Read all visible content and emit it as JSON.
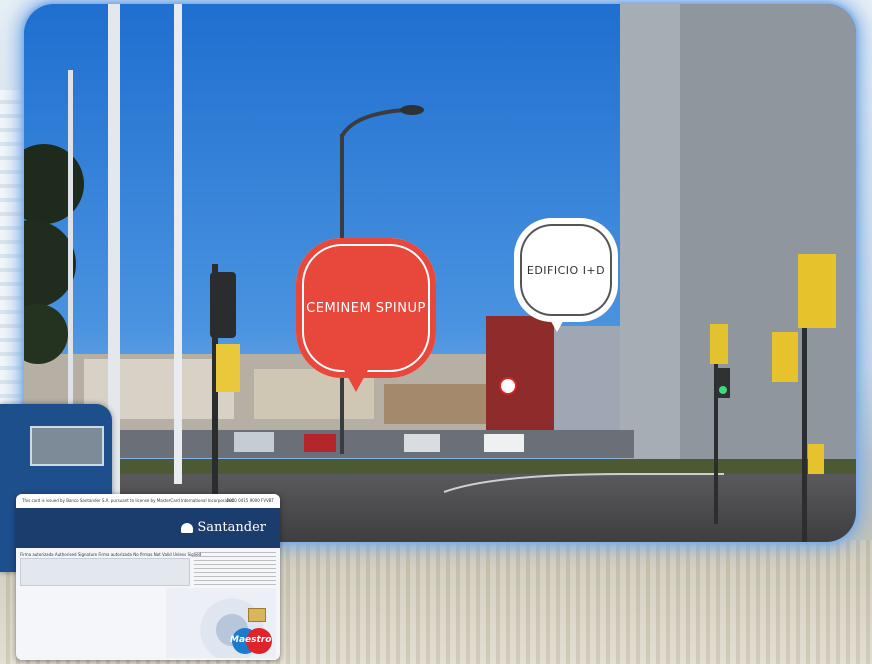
{
  "bubbles": {
    "red_label": "CEMINEM SPINUP",
    "white_label": "EDIFICIO I+D"
  },
  "card": {
    "brand": "Santander",
    "legal_text": "This card is issued by Banco Santander S.A. pursuant to license by MasterCard International Incorporated.",
    "card_number_fragment": "2020 0415 9000 FVVBT",
    "signature_label": "Firma autorizada  Authorised Signature  Firma autorizada  No firmas  Not Valid Unless Signed",
    "network": "Maestro"
  },
  "colors": {
    "sky": "#2f7fd6",
    "bubble_red": "#e8473c",
    "bubble_white": "#ffffff",
    "frame_glow": "#8ab6ea",
    "card_band": "#1a3d6e"
  }
}
